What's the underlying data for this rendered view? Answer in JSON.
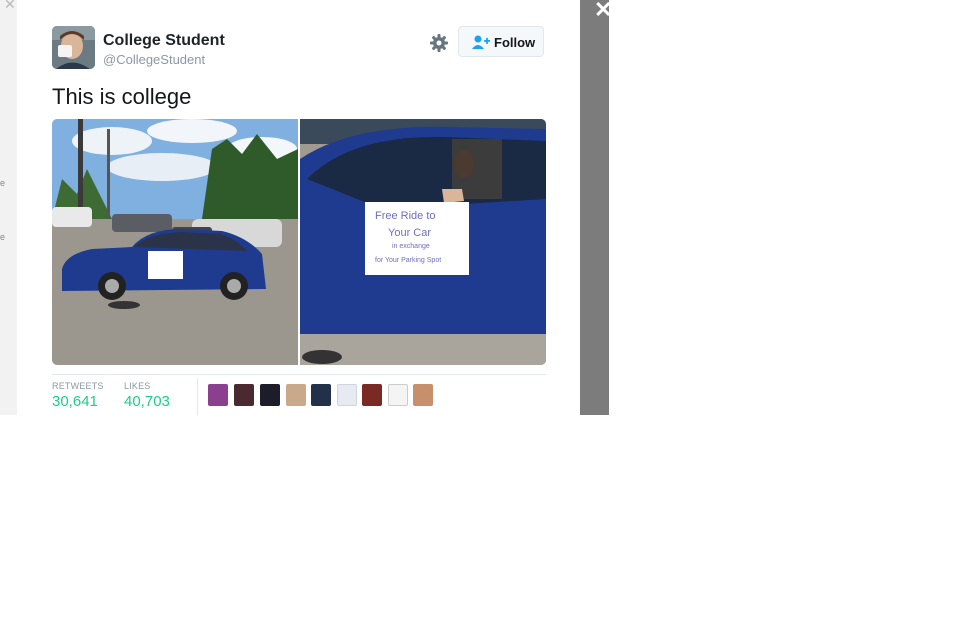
{
  "bg": {
    "close_glyph": "✕",
    "frag1": "e",
    "frag2": "e"
  },
  "modal": {
    "close_glyph": "✕"
  },
  "tweet": {
    "display_name": "College Student",
    "handle": "@CollegeStudent",
    "follow_label": "Follow",
    "text": "This is college",
    "stats": {
      "retweets_label": "RETWEETS",
      "retweets_value": "30,641",
      "likes_label": "LIKES",
      "likes_value": "40,703"
    },
    "liker_count": 9
  },
  "colors": {
    "accent": "#19cf86",
    "link": "#1da1f2",
    "car": "#1f3b8f"
  }
}
